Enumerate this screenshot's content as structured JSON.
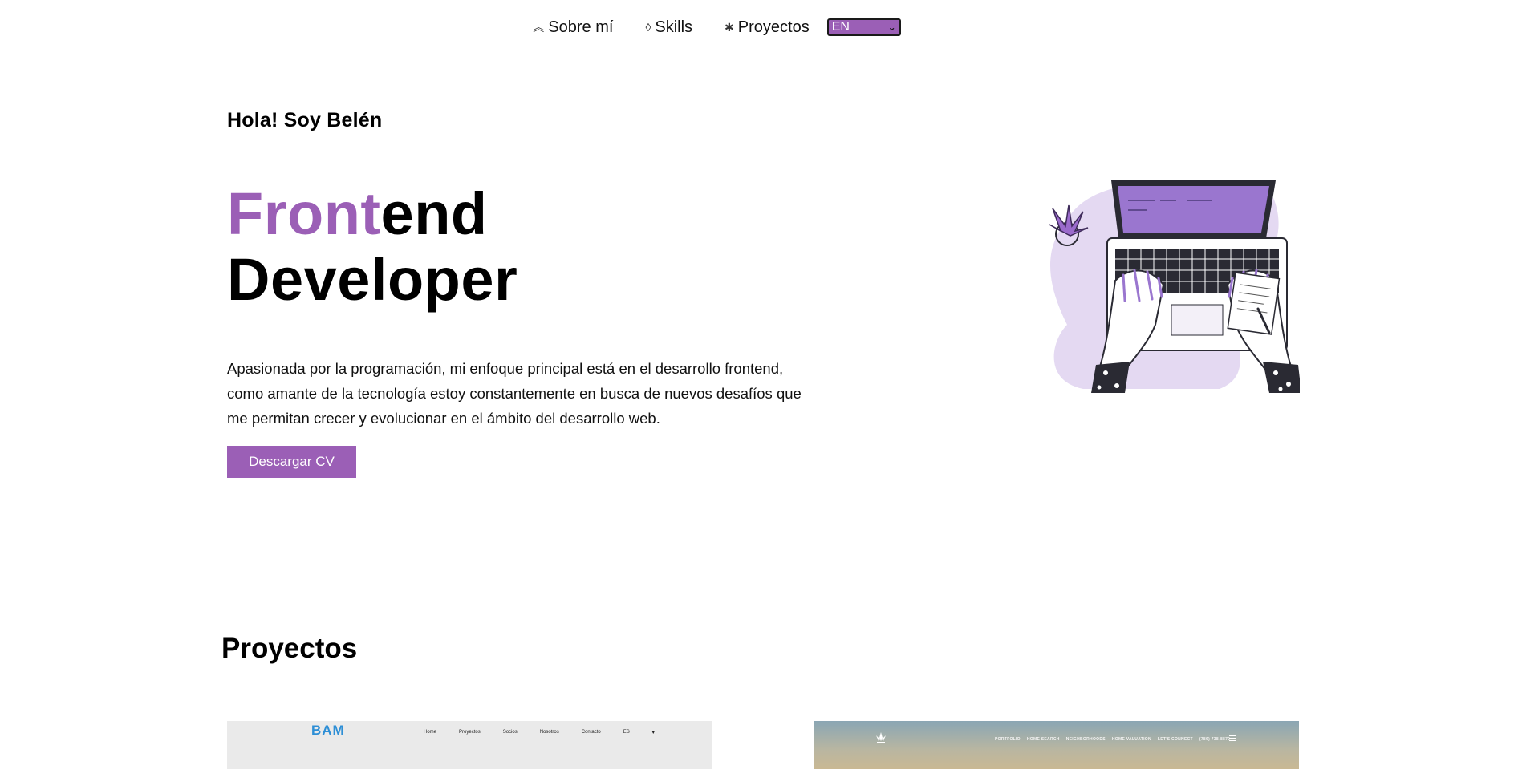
{
  "nav": {
    "items": [
      {
        "icon": "chevrons-up-icon",
        "glyph": "︽",
        "label": "Sobre mí"
      },
      {
        "icon": "diamond-icon",
        "glyph": "◊",
        "label": "Skills"
      },
      {
        "icon": "asterisk-icon",
        "glyph": "✱",
        "label": "Proyectos"
      }
    ],
    "language": {
      "selected": "EN"
    }
  },
  "hero": {
    "greeting": "Hola! Soy Belén",
    "title_accent": "Front",
    "title_rest": "end",
    "title_line2": "Developer",
    "description": "Apasionada por la programación, mi enfoque principal está en el desarrollo frontend, como amante de la tecnología estoy constantemente en busca de nuevos desafíos que me permitan crecer y evolucionar en el ámbito del desarrollo web.",
    "cv_button": "Descargar CV",
    "illustration": "laptop-typing-illustration"
  },
  "projects": {
    "title": "Proyectos",
    "cards": [
      {
        "preview_logo": "BAM",
        "preview_nav": [
          "Home",
          "Proyectos",
          "Socios",
          "Nosotros",
          "Contacto",
          "ES",
          "▾"
        ]
      },
      {
        "preview_nav": [
          "PORTFOLIO",
          "HOME SEARCH",
          "NEIGHBORHOODS",
          "HOME VALUATION",
          "LET'S CONNECT",
          "(786) 738-8870"
        ]
      }
    ]
  },
  "colors": {
    "accent": "#9b5fb6",
    "illustration_blob": "#e4d9f2",
    "text": "#000000"
  }
}
